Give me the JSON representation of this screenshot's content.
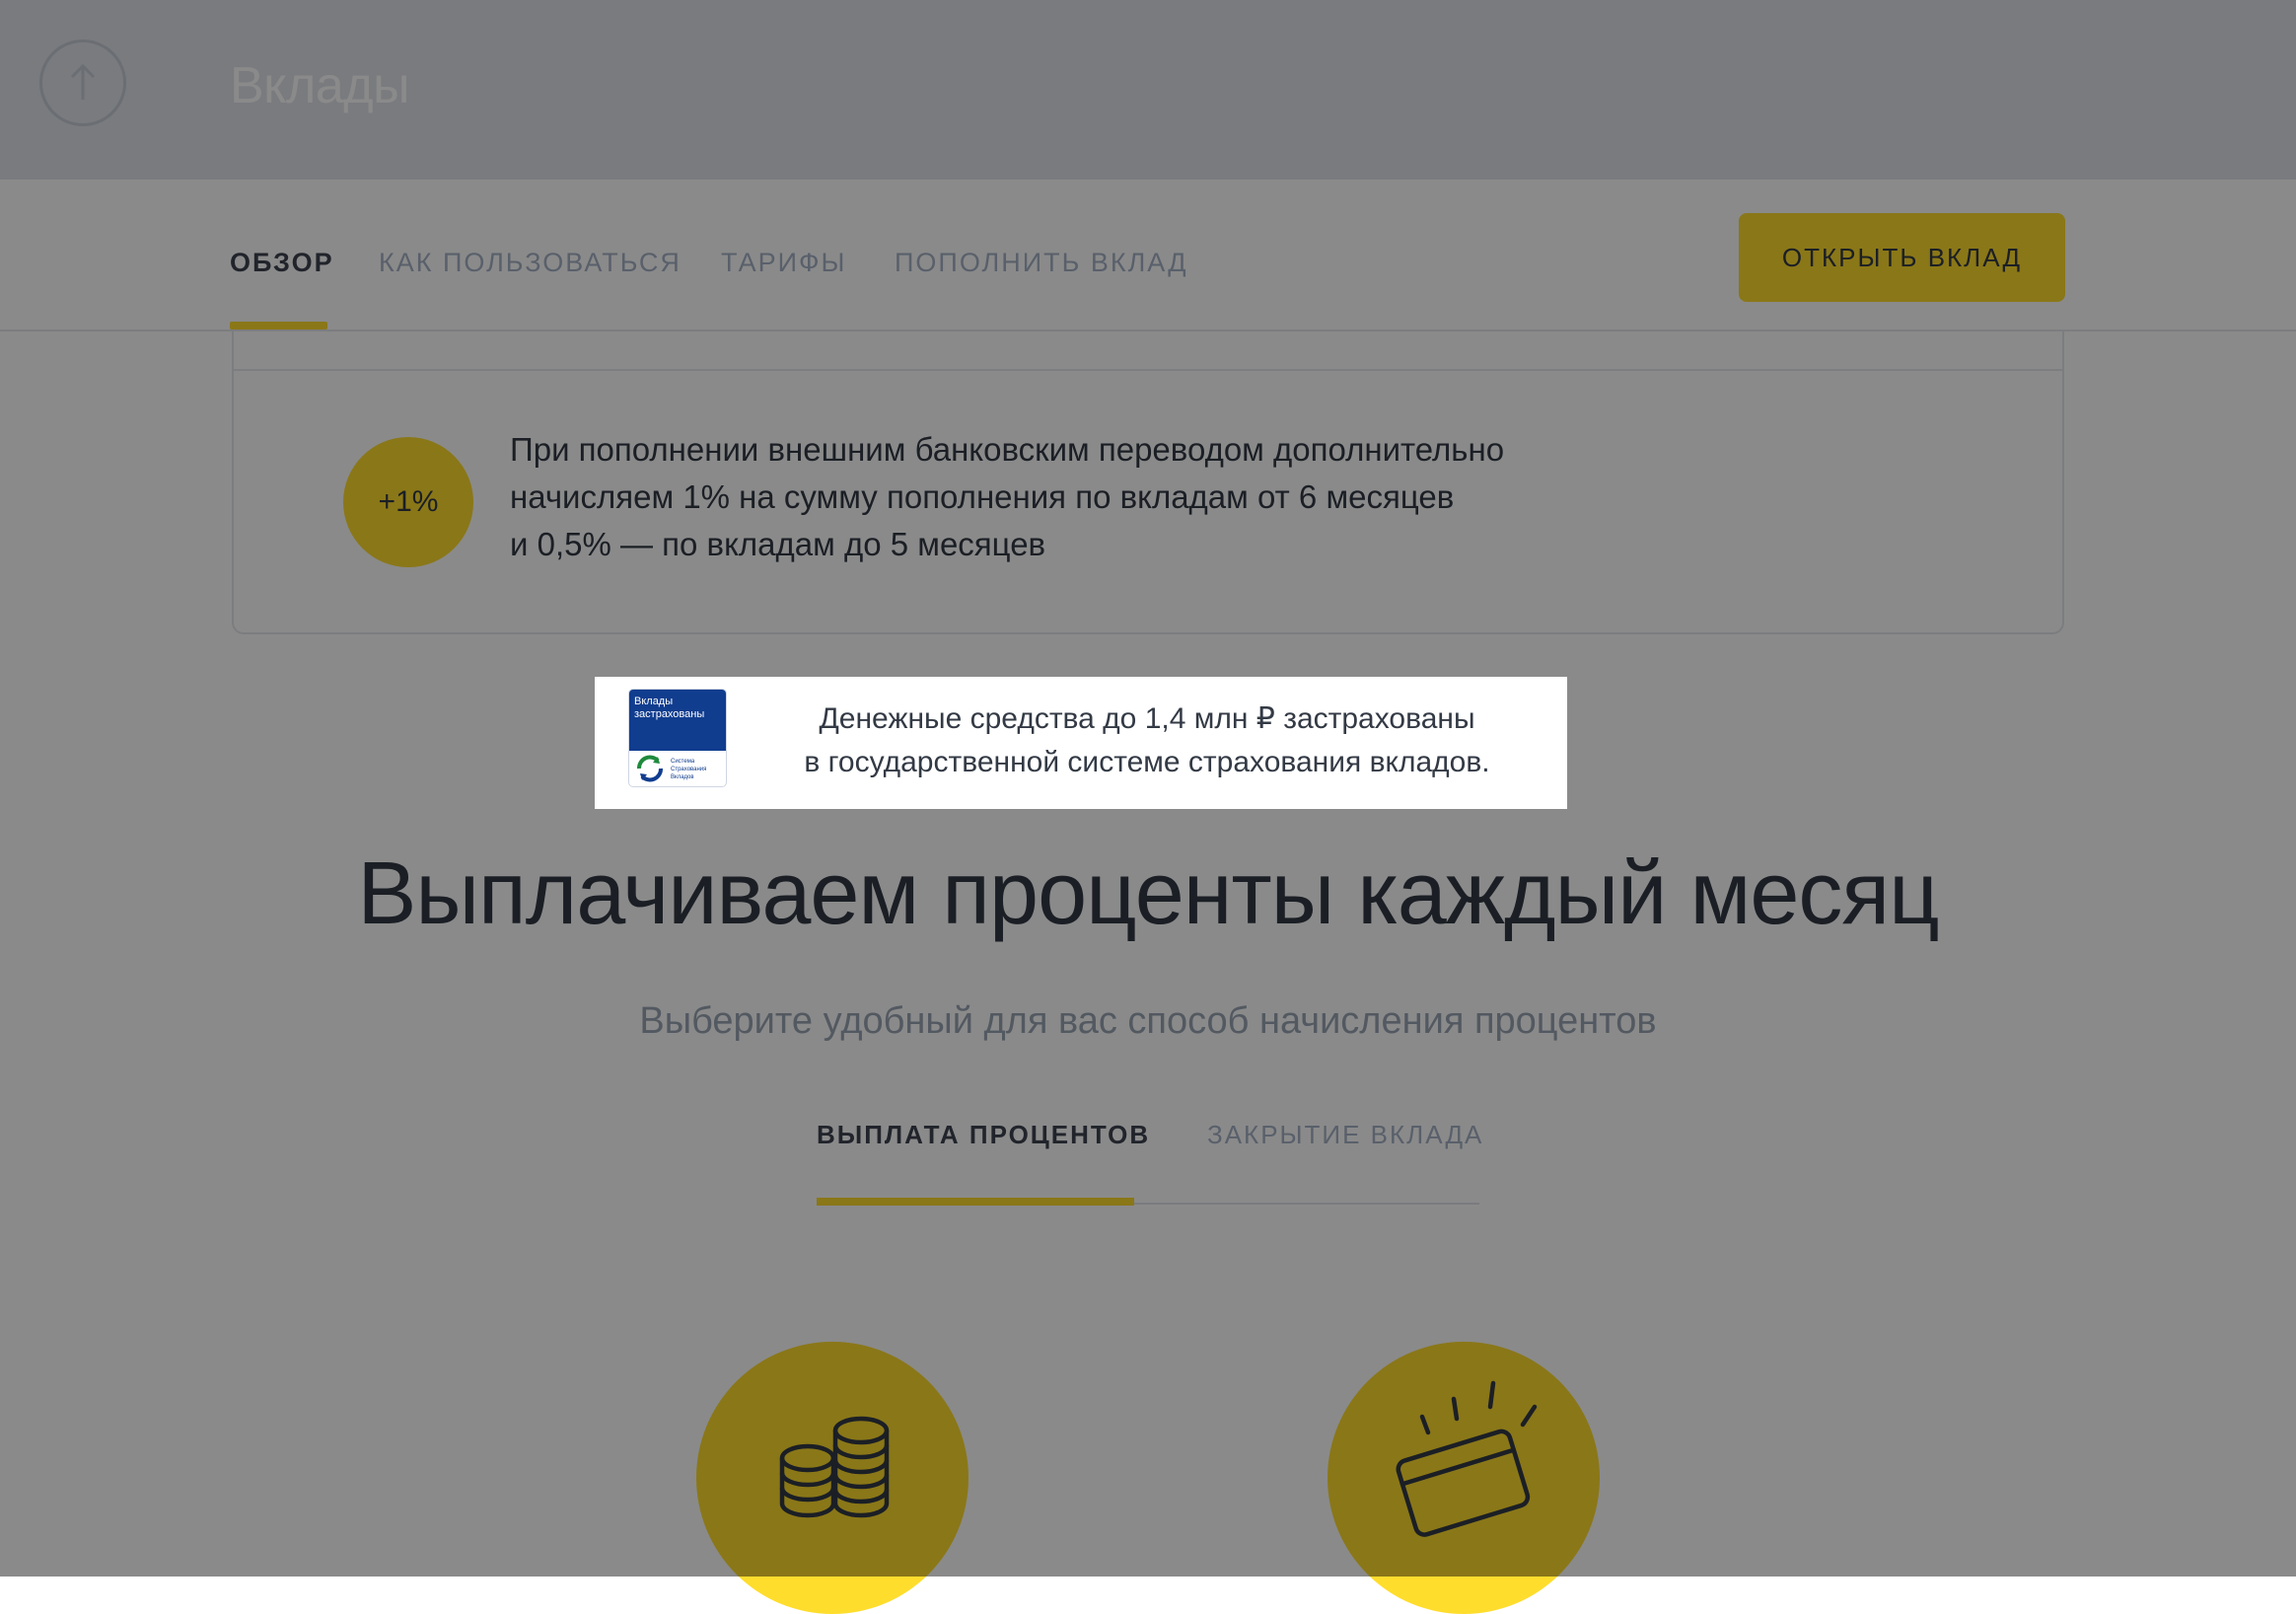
{
  "header": {
    "title": "Вклады",
    "scroll_up_icon": "arrow-up-icon"
  },
  "subnav": {
    "tabs": [
      {
        "label": "Обзор",
        "active": true
      },
      {
        "label": "Как пользоваться",
        "active": false
      },
      {
        "label": "Тарифы",
        "active": false
      },
      {
        "label": "Пополнить вклад",
        "active": false
      }
    ],
    "open_button": "Открыть вклад"
  },
  "bonus": {
    "badge": "+1%",
    "lines": [
      "При пополнении внешним банковским переводом дополнительно",
      "начисляем 1% на сумму пополнения по вкладам от 6 месяцев",
      "и 0,5% — по вкладам до 5 месяцев"
    ]
  },
  "insurance": {
    "logo_title": "Вклады застрахованы",
    "logo_org": "Система Страхования Вкладов",
    "lines": [
      "Денежные средства до 1,4 млн ₽ застрахованы",
      "в государственной системе страхования вкладов."
    ]
  },
  "main": {
    "headline": "Выплачиваем проценты каждый месяц",
    "subheadline": "Выберите удобный для вас способ начисления процентов",
    "tabs": [
      {
        "label": "Выплата процентов",
        "active": true
      },
      {
        "label": "Закрытие вклада",
        "active": false
      }
    ],
    "features": [
      {
        "icon": "coins-stack-icon"
      },
      {
        "icon": "card-payment-icon"
      }
    ]
  },
  "colors": {
    "accent": "#ffdd2d",
    "text": "#333a45",
    "muted_tab": "#a5b2c6",
    "insurance_blue": "#113d8f",
    "overlay": "rgba(0,0,0,0.46)"
  }
}
